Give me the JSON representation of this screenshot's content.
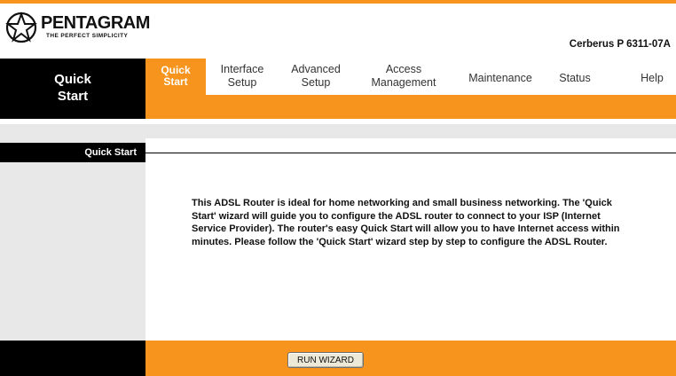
{
  "brand": {
    "name": "PENTAGRAM",
    "tagline": "THE PERFECT SIMPLICITY",
    "model": "Cerberus P 6311-07A"
  },
  "left_title": "Quick\nStart",
  "nav": [
    {
      "label": "Quick\nStart",
      "active": true
    },
    {
      "label": "Interface\nSetup"
    },
    {
      "label": "Advanced\nSetup"
    },
    {
      "label": "Access\nManagement"
    },
    {
      "label": "Maintenance"
    },
    {
      "label": "Status"
    },
    {
      "label": "Help"
    }
  ],
  "section_title": "Quick Start",
  "description": "This ADSL Router is ideal for home networking and small business networking. The 'Quick Start' wizard will guide you to configure the ADSL router to connect to your ISP (Internet Service Provider). The router's easy Quick Start will allow you to have Internet access within minutes. Please follow the 'Quick Start' wizard step by step to configure the ADSL Router.",
  "run_button": "RUN WIZARD",
  "colors": {
    "accent": "#f7941d",
    "black": "#000000",
    "gray": "#e8e8e8"
  }
}
